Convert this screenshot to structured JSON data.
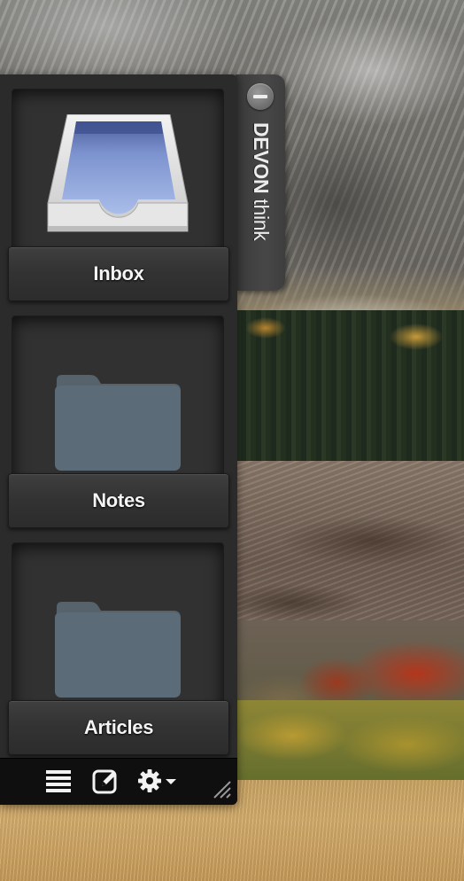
{
  "side_tab": {
    "brand_bold": "DEVON",
    "brand_regular": "think"
  },
  "tiles": [
    {
      "label": "Inbox",
      "icon": "inbox-tray-icon"
    },
    {
      "label": "Notes",
      "icon": "folder-icon"
    },
    {
      "label": "Articles",
      "icon": "folder-icon"
    }
  ],
  "toolbar": {
    "buttons": [
      "list-view-icon",
      "new-note-icon",
      "gear-menu-icon"
    ]
  },
  "colors": {
    "panel": "#2b2b2b",
    "folder": "#5b6b78",
    "inbox_blue": "#8fa9de"
  }
}
